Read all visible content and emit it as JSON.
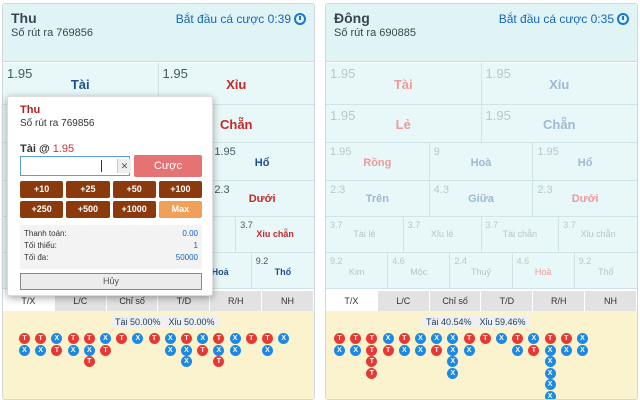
{
  "left": {
    "name": "Thu",
    "draw": "Số rút ra 769856",
    "countdown": "Bắt đầu cá cược 0:39",
    "row1": [
      {
        "odd": "1.95",
        "label": "Tài"
      },
      {
        "odd": "1.95",
        "label": "Xỉu"
      }
    ],
    "row2": [
      {
        "odd": "",
        "label": ""
      },
      {
        "odd": "",
        "label": "Chẵn"
      }
    ],
    "row3": [
      {
        "odd": "",
        "label": ""
      },
      {
        "odd": "1.95",
        "label": "Hổ"
      }
    ],
    "row4": [
      {
        "odd": "",
        "label": ""
      },
      {
        "odd": "2.3",
        "label": "Dưới"
      }
    ],
    "row5": [
      {
        "odd": "",
        "label": ""
      },
      {
        "odd": "3.7",
        "label": "Xỉu chẵn"
      }
    ],
    "row6": [
      {
        "odd": "",
        "label": ""
      },
      {
        "odd": "",
        "label": ""
      },
      {
        "odd": "",
        "label": ""
      },
      {
        "odd": "",
        "label": "Hoả"
      },
      {
        "odd": "9.2",
        "label": "Thổ"
      }
    ],
    "tabs": [
      "T/X",
      "L/C",
      "Chỉ số",
      "T/D",
      "R/H",
      "NH"
    ],
    "pct_tai": "Tài 50.00%",
    "pct_xiu": "Xỉu 50.00%",
    "beads": [
      [
        "T",
        "X"
      ],
      [
        "T",
        "X"
      ],
      [
        "X",
        "T"
      ],
      [
        "T",
        "X"
      ],
      [
        "T",
        "X",
        "T"
      ],
      [
        "X",
        "T"
      ],
      [
        "T"
      ],
      [
        "X"
      ],
      [
        "T"
      ],
      [
        "X",
        "X"
      ],
      [
        "T",
        "X",
        "X"
      ],
      [
        "X",
        "T"
      ],
      [
        "T",
        "X",
        "T"
      ],
      [
        "X",
        "X"
      ],
      [
        "T"
      ],
      [
        "T",
        "X"
      ],
      [
        "X"
      ]
    ]
  },
  "right": {
    "name": "Đông",
    "draw": "Số rút ra 690885",
    "countdown": "Bắt đầu cá cược 0:35",
    "row1": [
      {
        "odd": "1.95",
        "label": "Tài"
      },
      {
        "odd": "1.95",
        "label": "Xỉu"
      }
    ],
    "row2": [
      {
        "odd": "1.95",
        "label": "Lẻ"
      },
      {
        "odd": "1.95",
        "label": "Chẵn"
      }
    ],
    "row3": [
      {
        "odd": "1.95",
        "label": "Rồng"
      },
      {
        "odd": "9",
        "label": "Hoà"
      },
      {
        "odd": "1.95",
        "label": "Hổ"
      }
    ],
    "row4": [
      {
        "odd": "2.3",
        "label": "Trên"
      },
      {
        "odd": "4.3",
        "label": "Giữa"
      },
      {
        "odd": "2.3",
        "label": "Dưới"
      }
    ],
    "row5": [
      {
        "odd": "3.7",
        "label": "Tài lẻ"
      },
      {
        "odd": "3.7",
        "label": "Xỉu lẻ"
      },
      {
        "odd": "3.7",
        "label": "Tài chẵn"
      },
      {
        "odd": "3.7",
        "label": "Xỉu chẵn"
      }
    ],
    "row6": [
      {
        "odd": "9.2",
        "label": "Kim"
      },
      {
        "odd": "4.6",
        "label": "Mộc"
      },
      {
        "odd": "2.4",
        "label": "Thuỷ"
      },
      {
        "odd": "4.6",
        "label": "Hoả"
      },
      {
        "odd": "9.2",
        "label": "Thổ"
      }
    ],
    "tabs": [
      "T/X",
      "L/C",
      "Chỉ số",
      "T/D",
      "R/H",
      "NH"
    ],
    "pct_tai": "Tài 40.54%",
    "pct_xiu": "Xỉu 59.46%",
    "beads": [
      [
        "T",
        "X"
      ],
      [
        "T",
        "X"
      ],
      [
        "T",
        "T",
        "T",
        "T"
      ],
      [
        "X",
        "T"
      ],
      [
        "T",
        "X"
      ],
      [
        "X",
        "X"
      ],
      [
        "X",
        "T"
      ],
      [
        "X",
        "X",
        "X",
        "X"
      ],
      [
        "T",
        "X"
      ],
      [
        "T"
      ],
      [
        "X"
      ],
      [
        "T",
        "X"
      ],
      [
        "X",
        "T"
      ],
      [
        "T",
        "X",
        "X",
        "X",
        "X",
        "X"
      ],
      [
        "T",
        "X"
      ],
      [
        "X",
        "X"
      ]
    ]
  },
  "popup": {
    "name": "Thu",
    "draw": "Số rút ra 769856",
    "pick": "Tài @",
    "pick_odd": "1.95",
    "clear": "✕",
    "bet_label": "Cược",
    "chips": [
      "+10",
      "+25",
      "+50",
      "+100",
      "+250",
      "+500",
      "+1000",
      "Max"
    ],
    "pay_label": "Thanh toán:",
    "pay_value": "0.00",
    "min_label": "Tối thiểu:",
    "min_value": "1",
    "max_label": "Tối đa:",
    "max_value": "50000",
    "cancel_label": "Hủy"
  },
  "colors": {
    "accent": "#1565c0",
    "red": "#c62828",
    "chip": "#8b3a0e",
    "bet": "#e57373"
  }
}
